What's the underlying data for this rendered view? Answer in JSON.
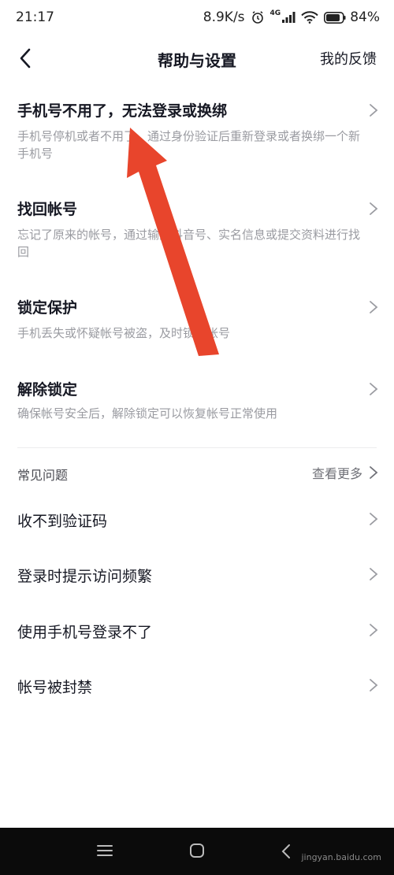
{
  "status_bar": {
    "time": "21:17",
    "speed": "8.9K/s",
    "network": "4G",
    "battery": "84%"
  },
  "nav": {
    "title": "帮助与设置",
    "feedback": "我的反馈"
  },
  "items": [
    {
      "title": "手机号不用了，无法登录或换绑",
      "desc": "手机号停机或者不用了，通过身份验证后重新登录或者换绑一个新手机号"
    },
    {
      "title": "找回帐号",
      "desc": "忘记了原来的帐号，通过输入抖音号、实名信息或提交资料进行找回"
    },
    {
      "title": "锁定保护",
      "desc": "手机丢失或怀疑帐号被盗，及时锁定帐号"
    },
    {
      "title": "解除锁定",
      "desc": "确保帐号安全后，解除锁定可以恢复帐号正常使用"
    }
  ],
  "faq": {
    "label": "常见问题",
    "more": "查看更多",
    "items": [
      "收不到验证码",
      "登录时提示访问频繁",
      "使用手机号登录不了",
      "帐号被封禁"
    ]
  },
  "watermark": "jingyan.baidu.com",
  "colors": {
    "annotation_arrow": "#e8452c",
    "text_primary": "#161823",
    "text_secondary": "#9a9ba1"
  }
}
